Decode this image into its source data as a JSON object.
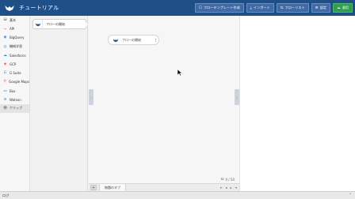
{
  "app": {
    "title": "チュートリアル",
    "logo_icon": "bird-logo-icon"
  },
  "header_buttons": [
    {
      "icon": "☐",
      "icon_name": "template-icon",
      "label": "フローテンプレート作成"
    },
    {
      "icon": "⤓",
      "icon_name": "import-icon",
      "label": "インポート"
    },
    {
      "icon": "⇆",
      "icon_name": "flowlist-icon",
      "label": "フローリスト"
    },
    {
      "icon": "⚙",
      "icon_name": "gear-icon",
      "label": "設定"
    },
    {
      "icon": "☁",
      "icon_name": "cloud-upload-icon",
      "label": "適用"
    }
  ],
  "sidebar": {
    "items": [
      {
        "icon": "⛁",
        "icon_name": "basic-icon",
        "icon_color": "#1f4f87",
        "label": "基本"
      },
      {
        "icon": "⤳",
        "icon_name": "api-icon",
        "icon_color": "#e05a2b",
        "label": "API"
      },
      {
        "icon": "◉",
        "icon_name": "bigquery-icon",
        "icon_color": "#4285f4",
        "label": "BigQuery"
      },
      {
        "icon": "◎",
        "icon_name": "machine-learning-icon",
        "icon_color": "#3a7bd5",
        "label": "機械学習"
      },
      {
        "icon": "☁",
        "icon_name": "salesforce-icon",
        "icon_color": "#1798c1",
        "label": "Salesforce"
      },
      {
        "icon": "◈",
        "icon_name": "gcp-icon",
        "icon_color": "#ea4335",
        "label": "GCP"
      },
      {
        "icon": "G",
        "icon_name": "gsuite-icon",
        "icon_color": "#4285f4",
        "label": "G Suite"
      },
      {
        "icon": "⚲",
        "icon_name": "google-maps-icon",
        "icon_color": "#ea4335",
        "label": "Google Maps"
      },
      {
        "icon": "▭",
        "icon_name": "box-icon",
        "icon_color": "#0061d5",
        "label": "Box"
      },
      {
        "icon": "≋",
        "icon_name": "watson-icon",
        "icon_color": "#1f70c1",
        "label": "Watson"
      },
      {
        "icon": "👁",
        "icon_name": "eye-icon",
        "icon_color": "#555555",
        "label": "クリップ"
      }
    ],
    "active_index": 10
  },
  "node_panel": {
    "node_label": "フローの開始"
  },
  "workspace": {
    "node_label": "フローの開始",
    "counter": "0 / 50",
    "counter_icon": "⛁"
  },
  "sheetbar": {
    "add_label": "+",
    "tab_label": "無題のタブ",
    "nav": [
      "⇤",
      "◂",
      "▸",
      "⇥"
    ]
  },
  "logbar": {
    "label": "ログ",
    "toggle": "⌃"
  }
}
